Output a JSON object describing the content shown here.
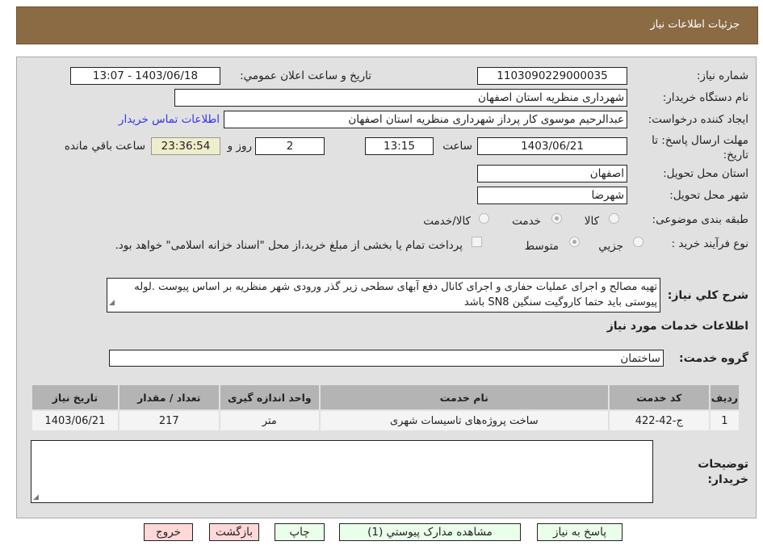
{
  "header": {
    "title": "جزئیات اطلاعات نیاز"
  },
  "form": {
    "need_number": {
      "label": "شماره نیاز:",
      "value": "1103090229000035"
    },
    "announce": {
      "label": "تاريخ و ساعت اعلان عمومي:",
      "value": "1403/06/18 - 13:07"
    },
    "buyer": {
      "label": "نام دستگاه خریدار:",
      "value": "شهرداری منظریه استان اصفهان"
    },
    "creator": {
      "label": "ایجاد کننده درخواست:",
      "value": "عبدالرحیم موسوی کار پرداز  شهرداری منظریه استان اصفهان"
    },
    "contact_link": "اطلاعات تماس خریدار",
    "deadline": {
      "label": "مهلت ارسال پاسخ: تا تاریخ:",
      "date": "1403/06/21",
      "time_label": "ساعت",
      "time": "13:15",
      "days": "2",
      "days_label": "روز و",
      "remaining": "23:36:54",
      "remaining_label": "ساعت باقي مانده"
    },
    "province": {
      "label": "استان محل تحویل:",
      "value": "اصفهان"
    },
    "city": {
      "label": "شهر محل تحویل:",
      "value": "شهرضا"
    },
    "category": {
      "label": "طبقه بندی موضوعی:",
      "options": [
        "کالا",
        "خدمت",
        "کالا/خدمت"
      ],
      "selected": "خدمت"
    },
    "purchase_type": {
      "label": "نوع فرآیند خرید :",
      "options": [
        "جزيي",
        "متوسط"
      ],
      "selected": "متوسط",
      "treasury_note": "پرداخت تمام یا بخشی از مبلغ خرید،از محل \"اسناد خزانه اسلامی\" خواهد بود.",
      "treasury_checked": false
    },
    "description": {
      "label": "شرح كلي نياز:",
      "value": "تهیه مصالح و اجرای عملیات حفاری و اجرای کانال دفع آبهای سطحی زیر گذر ورودی شهر منظریه  بر اساس پیوست .لوله پیوستی باید حتما کاروگیت سنگین SN8 باشد"
    }
  },
  "services": {
    "title": "اطلاعات خدمات مورد نیاز",
    "group_label": "گروه خدمت:",
    "group_value": "ساختمان",
    "columns": [
      "ردیف",
      "کد خدمت",
      "نام خدمت",
      "واحد اندازه گیری",
      "تعداد / مقدار",
      "تاریخ نیاز"
    ],
    "rows": [
      [
        "1",
        "ج-42-422",
        "ساخت پروژه‌های تاسیسات شهری",
        "متر",
        "217",
        "1403/06/21"
      ]
    ]
  },
  "notes": {
    "label": "توضیحات خریدار:",
    "value": ""
  },
  "buttons": {
    "reply": "پاسخ به نیاز",
    "attachments": "مشاهده مدارک پیوستي (1)",
    "print": "چاپ",
    "back": "بازگشت",
    "exit": "خروج"
  }
}
